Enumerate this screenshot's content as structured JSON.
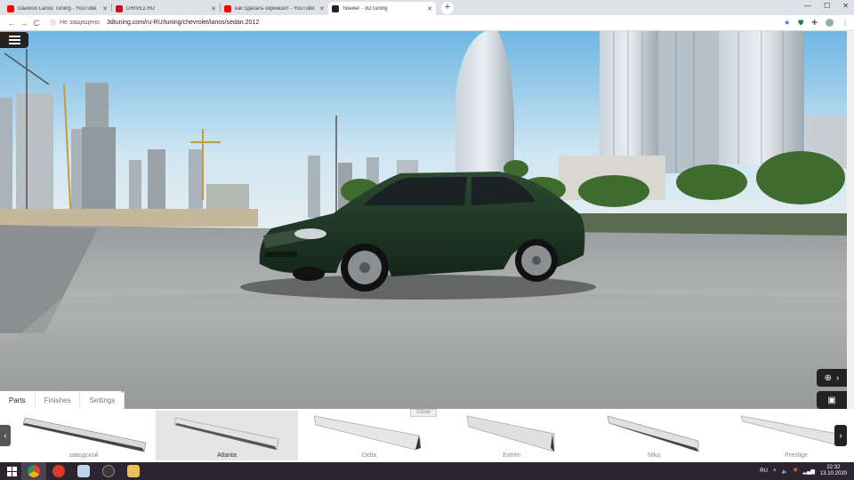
{
  "browser": {
    "tabs": [
      {
        "title": "Daewoo Lanos Tuning - YouTube",
        "favicon_color": "#ff0000"
      },
      {
        "title": "DRIVE2.RU",
        "favicon_color": "#c4161c"
      },
      {
        "title": "как сделать скриншот - YouTube",
        "favicon_color": "#ff0000"
      },
      {
        "title": "тюнинг - 3DTuning",
        "favicon_color": "#222222"
      }
    ],
    "active_tab": 3,
    "new_tab_label": "+",
    "window": {
      "minimize": "—",
      "maximize": "☐",
      "close": "✕"
    },
    "nav": {
      "back": "←",
      "forward": "→",
      "reload": "C"
    },
    "security_label": "Не защищено",
    "url": "3dtuning.com/ru-RU/tuning/chevrolet/lanos/sedan.2012"
  },
  "app": {
    "part_tabs": [
      "Parts",
      "Finishes",
      "Settings"
    ],
    "active_part_tab": 0,
    "close_label": "Close",
    "parts": [
      {
        "label": "заводской"
      },
      {
        "label": "Atlanta"
      },
      {
        "label": "Delta"
      },
      {
        "label": "Extrim"
      },
      {
        "label": "Nika"
      },
      {
        "label": "Prestige"
      }
    ],
    "selected_part": 1,
    "car_color": "#1f3a24"
  },
  "taskbar": {
    "language": "RU",
    "time": "22:32",
    "date": "13.10.2020"
  }
}
